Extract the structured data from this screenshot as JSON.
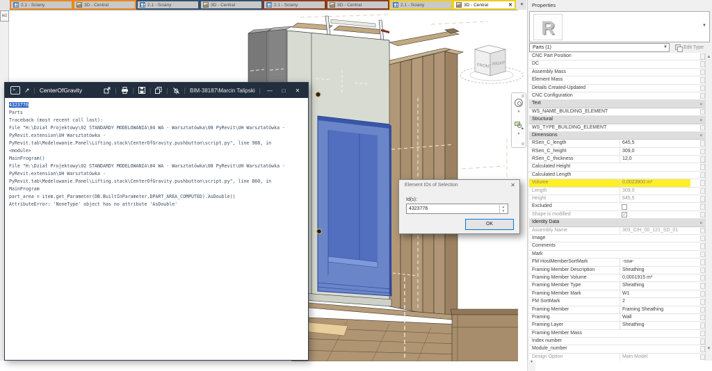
{
  "tab_bar": {
    "overflow_icon": "▼",
    "tabs": [
      {
        "label": "2.1 - Ściany",
        "icon": "plan-icon",
        "group_color": "#E8871E",
        "active": false
      },
      {
        "label": "3D - Central",
        "icon": "3d-icon",
        "group_color": "#E8871E",
        "active": false
      },
      {
        "label": "2.1 - Ściany",
        "icon": "plan-icon",
        "group_color": "#31506E",
        "active": false
      },
      {
        "label": "3D - Central",
        "icon": "3d-icon",
        "group_color": "#31506E",
        "active": false
      },
      {
        "label": "2.1 - Ściany",
        "icon": "plan-icon",
        "group_color": "#8E3A1A",
        "active": false
      },
      {
        "label": "3D - Central",
        "icon": "3d-icon",
        "group_color": "#8E3A1A",
        "active": false
      },
      {
        "label": "2.1 - Ściany",
        "icon": "plan-icon",
        "group_color": "#F0CE1C",
        "active": false
      },
      {
        "label": "3D - Central",
        "icon": "3d-icon",
        "group_color": "#F0CE1C",
        "active": true
      }
    ]
  },
  "side_strip": {
    "tab_label": "ież"
  },
  "viewport": {
    "viewcube": {
      "front_label": "FRONT",
      "right_label": "RIGHT"
    },
    "selection_color": "#4d6dc6"
  },
  "console": {
    "title": "CenterOfGravity",
    "user": "BIM-38187\\Marcin Talipski",
    "lines": [
      {
        "text": "4323776",
        "selected": true
      },
      {
        "text": "Parts",
        "selected": false
      },
      {
        "text": "Traceback (most recent call last):",
        "selected": false
      },
      {
        "text": "File \"H:\\Dział Projektowy\\02 STANDARDY MODELOWANIA\\04 WA - Warsztatówka\\08 PyRevit\\UH Warsztatówka -",
        "selected": false
      },
      {
        "text": "PyRevit.extension\\UH Warsztatówka -",
        "selected": false
      },
      {
        "text": "PyRevit.tab\\Modelowanie.Panel\\Lifting.stack\\CenterOfGravity.pushbutton\\script.py\", line 988, in",
        "selected": false
      },
      {
        "text": "<module>",
        "selected": false
      },
      {
        "text": "MainProgram()",
        "selected": false
      },
      {
        "text": "File \"H:\\Dział Projektowy\\02 STANDARDY MODELOWANIA\\04 WA - Warsztatówka\\08 PyRevit\\UH Warsztatówka -",
        "selected": false
      },
      {
        "text": "PyRevit.extension\\UH Warsztatówka -",
        "selected": false
      },
      {
        "text": "PyRevit.tab\\Modelowanie.Panel\\Lifting.stack\\CenterOfGravity.pushbutton\\script.py\", line 860, in",
        "selected": false
      },
      {
        "text": "MainProgram",
        "selected": false
      },
      {
        "text": "part_area = item.get_Parameter(DB.BuiltInParameter.DPART_AREA_COMPUTED).AsDouble()",
        "selected": false
      },
      {
        "text": "AttributeError: 'NoneType' object has no attribute 'AsDouble'",
        "selected": false
      }
    ]
  },
  "dialog": {
    "title": "Element IDs of Selection",
    "id_label": "Id(s):",
    "id_value": "4323776",
    "ok_label": "OK"
  },
  "properties": {
    "title": "Properties",
    "type_letter": "R",
    "filter_value": "Parts (1)",
    "edit_type_label": "Edit Type",
    "rows": [
      {
        "name": "CNC Part Position",
        "value": "",
        "type": "param"
      },
      {
        "name": "DC",
        "value": "",
        "type": "param"
      },
      {
        "name": "Assembly Mass",
        "value": "",
        "type": "param"
      },
      {
        "name": "Element Mass",
        "value": "",
        "type": "param"
      },
      {
        "name": "Details Created-Updated",
        "value": "",
        "type": "param"
      },
      {
        "name": "CNC Configuration",
        "value": "",
        "type": "param"
      },
      {
        "name": "Text",
        "type": "section"
      },
      {
        "name": "WS_NAME_BUILDING_ELEMENT",
        "value": "",
        "type": "param"
      },
      {
        "name": "Structural",
        "type": "section"
      },
      {
        "name": "WS_TYPE_BUILDING_ELEMENT",
        "value": "",
        "type": "param"
      },
      {
        "name": "Dimensions",
        "type": "section"
      },
      {
        "name": "RSen_C_length",
        "value": "645,5",
        "type": "param"
      },
      {
        "name": "RSen_C_height",
        "value": "309,0",
        "type": "param"
      },
      {
        "name": "RSen_C_thickness",
        "value": "12,0",
        "type": "param"
      },
      {
        "name": "Calculated Height",
        "value": "",
        "type": "param"
      },
      {
        "name": "Calculated Length",
        "value": "",
        "type": "param"
      },
      {
        "name": "Volume",
        "value": "0,0023900 m³",
        "type": "param",
        "gray": true,
        "highlight": true
      },
      {
        "name": "Length",
        "value": "309,0",
        "type": "param",
        "gray": true
      },
      {
        "name": "Height",
        "value": "645,5",
        "type": "param",
        "gray": true
      },
      {
        "name": "Excluded",
        "value": "",
        "type": "param",
        "checkbox": "unchecked"
      },
      {
        "name": "Shape is modified",
        "value": "",
        "type": "param",
        "gray": true,
        "checkbox": "checked"
      },
      {
        "name": "Identity Data",
        "type": "section"
      },
      {
        "name": "Assembly Name",
        "value": "303_CIH_00_121_SD_01",
        "type": "param",
        "gray": true
      },
      {
        "name": "Image",
        "value": "",
        "type": "param"
      },
      {
        "name": "Comments",
        "value": "",
        "type": "param"
      },
      {
        "name": "Mark",
        "value": "",
        "type": "param"
      },
      {
        "name": "FM HostMemberSortMark",
        "value": "-ssw-",
        "type": "param"
      },
      {
        "name": "Framing Member Description",
        "value": "Sheathing",
        "type": "param"
      },
      {
        "name": "Framing Member Volume",
        "value": "0,0001915 m³",
        "type": "param"
      },
      {
        "name": "Framing Member Type",
        "value": "Sheathing",
        "type": "param"
      },
      {
        "name": "Framing Member Mark",
        "value": "W1",
        "type": "param"
      },
      {
        "name": "FM SortMark",
        "value": "2",
        "type": "param"
      },
      {
        "name": "Framing Member",
        "value": "Framing Sheathing",
        "type": "param"
      },
      {
        "name": "Framing",
        "value": "Wall",
        "type": "param"
      },
      {
        "name": "Framing Layer",
        "value": "Sheathing",
        "type": "param"
      },
      {
        "name": "Framing Member Mass",
        "value": "",
        "type": "param"
      },
      {
        "name": "Index number",
        "value": "",
        "type": "param"
      },
      {
        "name": "Module_number",
        "value": "",
        "type": "param"
      },
      {
        "name": "Design Option",
        "value": "Main Model",
        "type": "param",
        "gray": true
      }
    ]
  }
}
